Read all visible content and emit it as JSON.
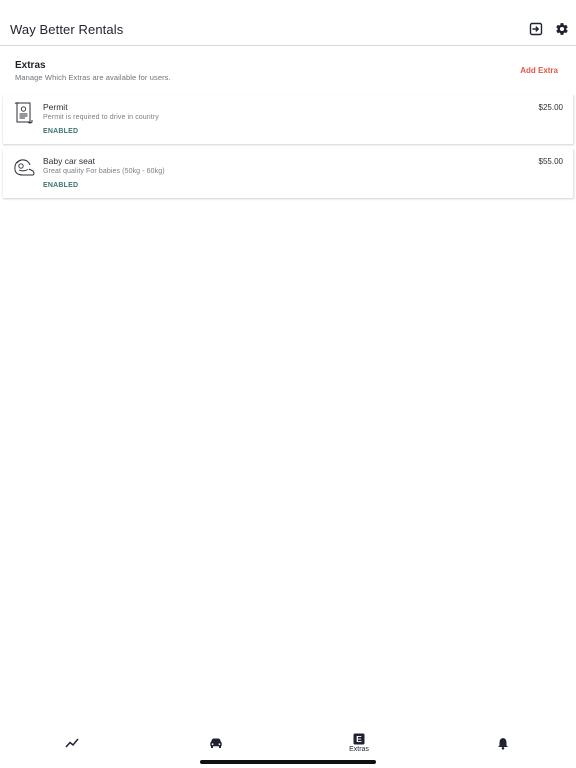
{
  "app": {
    "title": "Way Better Rentals"
  },
  "header_icons": {
    "logout": "logout-icon",
    "settings": "gear-icon"
  },
  "extras": {
    "title": "Extras",
    "subtitle": "Manage Which Extras are available for users.",
    "add_label": "Add Extra",
    "add_color": "#e2584a"
  },
  "items": [
    {
      "icon": "permit-document-icon",
      "name": "Permit",
      "description": "Permit is required to drive in country",
      "status": "ENABLED",
      "price": "$25.00"
    },
    {
      "icon": "baby-car-seat-icon",
      "name": "Baby car seat",
      "description": "Great quality For babies (50kg - 60kg)",
      "status": "ENABLED",
      "price": "$55.00"
    }
  ],
  "nav": {
    "tabs": [
      {
        "icon": "chart-icon",
        "label": ""
      },
      {
        "icon": "car-icon",
        "label": ""
      },
      {
        "icon": "extras-icon",
        "label": "Extras",
        "glyph": "E",
        "selected": true
      },
      {
        "icon": "bell-icon",
        "label": ""
      }
    ]
  },
  "colors": {
    "status": "#3c7474",
    "accent": "#e2584a",
    "text": "#1f2330"
  }
}
